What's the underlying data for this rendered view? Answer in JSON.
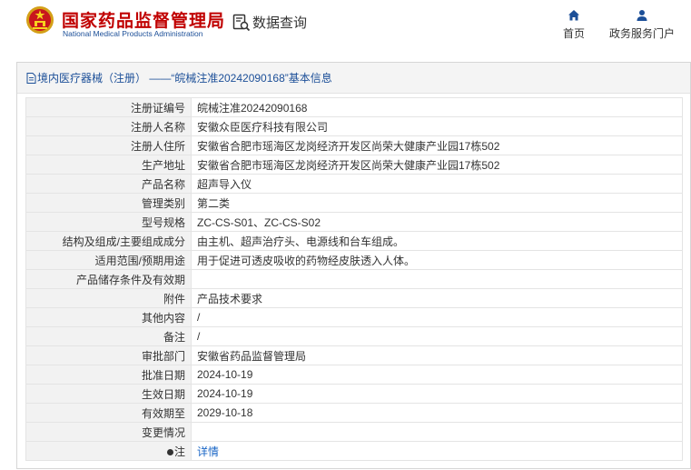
{
  "header": {
    "brand_cn": "国家药品监督管理局",
    "brand_en": "National Medical Products Administration",
    "search_label": "数据查询",
    "nav": {
      "home": "首页",
      "gov_services": "政务服务门户"
    }
  },
  "colors": {
    "brand_red": "#c00000",
    "link_blue": "#1a66c6",
    "key_bg": "#f2f2f2"
  },
  "breadcrumb": "境内医疗器械（注册） ——“皖械注准20242090168”基本信息",
  "rows": [
    {
      "k": "注册证编号",
      "v": "皖械注准20242090168"
    },
    {
      "k": "注册人名称",
      "v": "安徽众臣医疗科技有限公司"
    },
    {
      "k": "注册人住所",
      "v": "安徽省合肥市瑶海区龙岗经济开发区尚荣大健康产业园17栋502"
    },
    {
      "k": "生产地址",
      "v": "安徽省合肥市瑶海区龙岗经济开发区尚荣大健康产业园17栋502"
    },
    {
      "k": "产品名称",
      "v": "超声导入仪"
    },
    {
      "k": "管理类别",
      "v": "第二类"
    },
    {
      "k": "型号规格",
      "v": "ZC-CS-S01、ZC-CS-S02"
    },
    {
      "k": "结构及组成/主要组成成分",
      "v": "由主机、超声治疗头、电源线和台车组成。"
    },
    {
      "k": "适用范围/预期用途",
      "v": "用于促进可透皮吸收的药物经皮肤透入人体。"
    },
    {
      "k": "产品储存条件及有效期",
      "v": ""
    },
    {
      "k": "附件",
      "v": "产品技术要求"
    },
    {
      "k": "其他内容",
      "v": "/"
    },
    {
      "k": "备注",
      "v": "/"
    },
    {
      "k": "审批部门",
      "v": "安徽省药品监督管理局"
    },
    {
      "k": "批准日期",
      "v": "2024-10-19"
    },
    {
      "k": "生效日期",
      "v": "2024-10-19"
    },
    {
      "k": "有效期至",
      "v": "2029-10-18"
    },
    {
      "k": "变更情况",
      "v": ""
    }
  ],
  "note_row": {
    "k": "注",
    "v": "详情",
    "icon": "pin-icon"
  }
}
